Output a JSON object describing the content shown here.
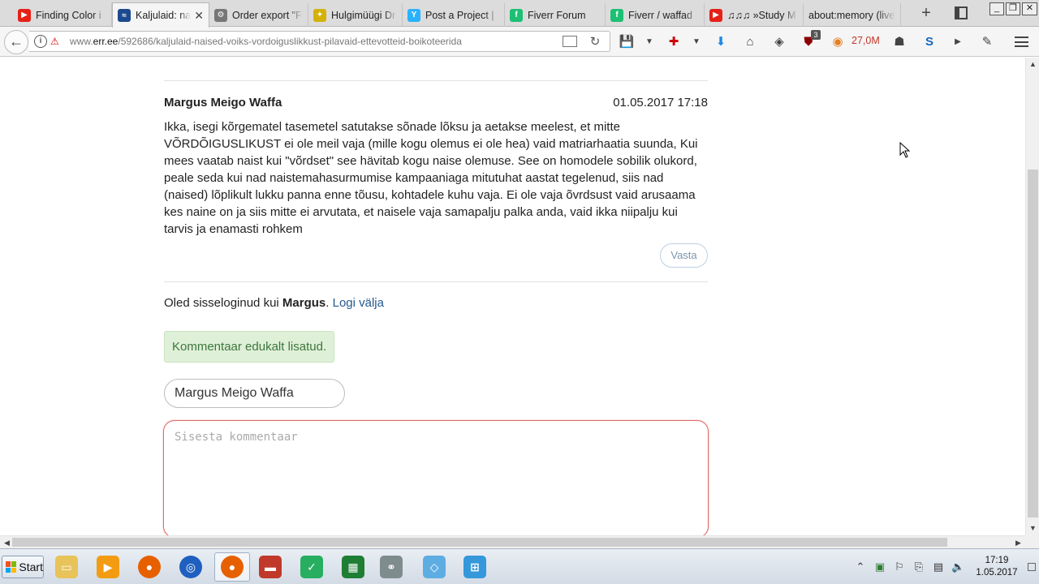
{
  "browser": {
    "tabs": [
      {
        "title": "Finding Color i",
        "icon": "youtube-icon",
        "color": "#e62117",
        "glyph": "▶"
      },
      {
        "title": "Kaljulaid: na",
        "icon": "err-icon",
        "color": "#1c4a8f",
        "glyph": "≈",
        "active": true
      },
      {
        "title": "Order export \"Fi",
        "icon": "gear-icon",
        "color": "#777777",
        "glyph": "⚙"
      },
      {
        "title": "Hulgimüügi Dr",
        "icon": "drone-icon",
        "color": "#d4b106",
        "glyph": "✦"
      },
      {
        "title": "Post a Project | ",
        "icon": "freelancer-icon",
        "color": "#29b2fe",
        "glyph": "Y"
      },
      {
        "title": "Fiverr Forum",
        "icon": "fiverr-icon",
        "color": "#1dbf73",
        "glyph": "f"
      },
      {
        "title": "Fiverr / waffad",
        "icon": "fiverr-icon",
        "color": "#1dbf73",
        "glyph": "f"
      },
      {
        "title": "♫♫♫ »Study M",
        "icon": "youtube-icon",
        "color": "#e62117",
        "glyph": "▶"
      },
      {
        "title": "about:memory (live",
        "icon": "none",
        "color": "",
        "glyph": ""
      }
    ],
    "new_tab_label": "+",
    "url": {
      "prefix": "www.",
      "domain": "err.ee",
      "path": "/592686/kaljulaid-naised-voiks-vordoiguslikkust-pilavaid-ettevotteid-boikoteerida"
    },
    "memory_label": "27,0M",
    "addon_badge": "3"
  },
  "comment": {
    "author": "Margus Meigo Waffa",
    "date": "01.05.2017 17:18",
    "body": "Ikka, isegi kõrgematel tasemetel satutakse sõnade lõksu ja aetakse meelest, et mitte VÕRDÕIGUSLIKUST ei ole meil vaja (mille kogu olemus ei ole hea) vaid matriarhaatia suunda, Kui mees vaatab naist kui \"võrdset\" see hävitab kogu naise olemuse. See on homodele sobilik olukord, peale seda kui nad naistemahasurmumise kampaaniaga mitutuhat aastat tegelenud, siis nad (naised) lõplikult lukku panna enne tõusu, kohtadele kuhu vaja. Ei ole vaja õvrdsust vaid arusaama kes naine on ja siis mitte ei arvutata, et naisele vaja samapalju palka anda, vaid ikka niipalju kui tarvis ja enamasti rohkem",
    "reply_label": "Vasta"
  },
  "session": {
    "logged_in_prefix": "Oled sisseloginud kui ",
    "user": "Margus",
    "separator": ". ",
    "logout_label": "Logi välja"
  },
  "alert": {
    "success_text": "Kommentaar edukalt lisatud."
  },
  "form": {
    "name_value": "Margus Meigo Waffa",
    "comment_placeholder": "Sisesta kommentaar"
  },
  "taskbar": {
    "start_label": "Start",
    "time": "17:19",
    "date": "1.05.2017"
  },
  "colors": {
    "link": "#24598f",
    "success_bg": "#dff0d8",
    "success_text": "#3c763d",
    "error_border": "#e06a6a",
    "reply_border": "#bcd0e2"
  }
}
